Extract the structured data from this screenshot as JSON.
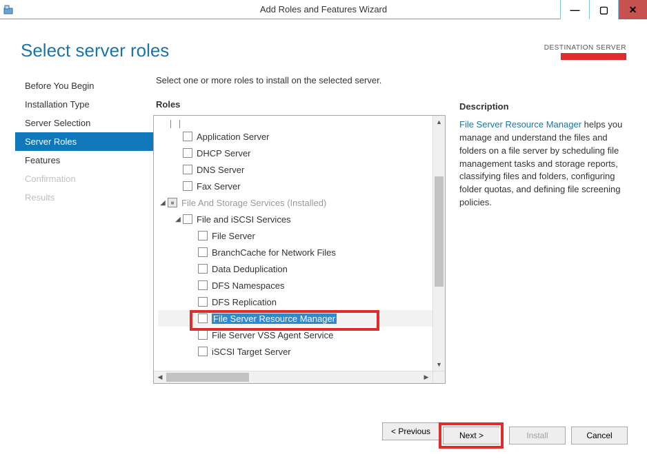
{
  "window": {
    "title": "Add Roles and Features Wizard"
  },
  "page": {
    "title": "Select server roles",
    "destination_label": "DESTINATION SERVER",
    "instruction": "Select one or more roles to install on the selected server.",
    "roles_heading": "Roles",
    "description_heading": "Description"
  },
  "nav": {
    "items": [
      {
        "label": "Before You Begin"
      },
      {
        "label": "Installation Type"
      },
      {
        "label": "Server Selection"
      },
      {
        "label": "Server Roles"
      },
      {
        "label": "Features"
      },
      {
        "label": "Confirmation"
      },
      {
        "label": "Results"
      }
    ]
  },
  "roles": {
    "tree": [
      {
        "label": "Application Server",
        "indent": 1,
        "chk": "unchecked"
      },
      {
        "label": "DHCP Server",
        "indent": 1,
        "chk": "unchecked"
      },
      {
        "label": "DNS Server",
        "indent": 1,
        "chk": "unchecked"
      },
      {
        "label": "Fax Server",
        "indent": 1,
        "chk": "unchecked"
      },
      {
        "label": "File And Storage Services (Installed)",
        "indent": 0,
        "chk": "indet",
        "expander": "open",
        "grey": true
      },
      {
        "label": "File and iSCSI Services",
        "indent": 1,
        "chk": "unchecked",
        "expander": "open"
      },
      {
        "label": "File Server",
        "indent": 2,
        "chk": "unchecked"
      },
      {
        "label": "BranchCache for Network Files",
        "indent": 2,
        "chk": "unchecked"
      },
      {
        "label": "Data Deduplication",
        "indent": 2,
        "chk": "unchecked"
      },
      {
        "label": "DFS Namespaces",
        "indent": 2,
        "chk": "unchecked"
      },
      {
        "label": "DFS Replication",
        "indent": 2,
        "chk": "unchecked"
      },
      {
        "label": "File Server Resource Manager",
        "indent": 2,
        "chk": "unchecked",
        "selected": true
      },
      {
        "label": "File Server VSS Agent Service",
        "indent": 2,
        "chk": "unchecked"
      },
      {
        "label": "iSCSI Target Server",
        "indent": 2,
        "chk": "unchecked"
      }
    ]
  },
  "description": {
    "link_text": "File Server Resource Manager",
    "text": " helps you manage and understand the files and folders on a file server by scheduling file management tasks and storage reports, classifying files and folders, configuring folder quotas, and defining file screening policies."
  },
  "footer": {
    "previous": "< Previous",
    "next": "Next >",
    "install": "Install",
    "cancel": "Cancel"
  }
}
